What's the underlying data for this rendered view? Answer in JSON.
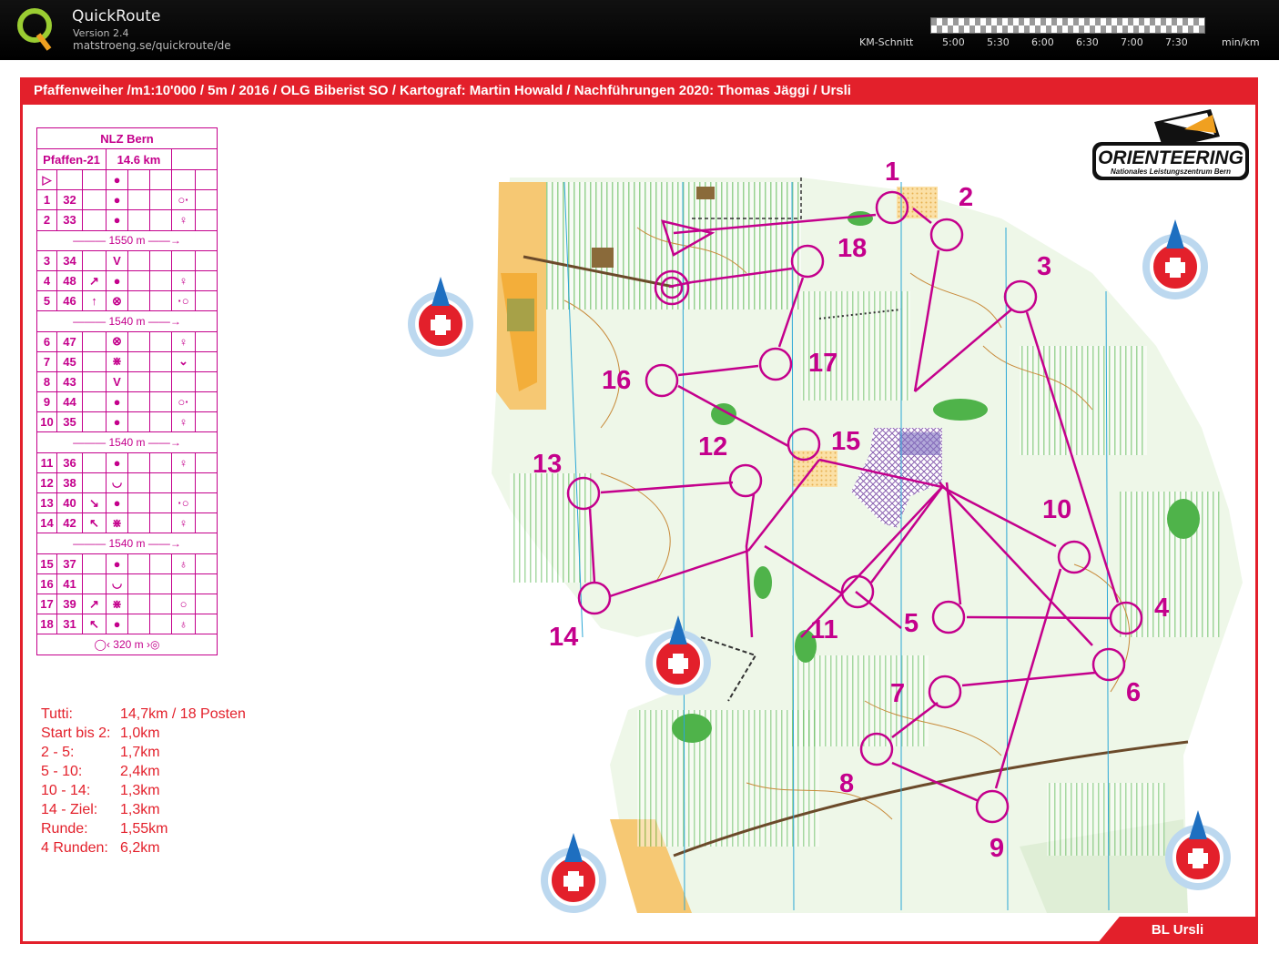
{
  "app": {
    "title": "QuickRoute",
    "version": "Version 2.4",
    "url": "matstroeng.se/quickroute/de"
  },
  "pace_scale": {
    "label": "KM-Schnitt",
    "ticks": [
      "5:00",
      "5:30",
      "6:00",
      "6:30",
      "7:00",
      "7:30"
    ],
    "unit": "min/km"
  },
  "map": {
    "title": "Pfaffenweiher /m1:10'000 / 5m / 2016 / OLG Biberist SO / Kartograf: Martin Howald / Nachführungen 2020: Thomas Jäggi / Ursli",
    "footer": "BL Ursli",
    "brand_main": "ORIENTEERING",
    "brand_sub": "Nationales Leistungszentrum Bern",
    "colors": {
      "frame": "#e3202b",
      "course": "#c4008c",
      "forest_green": "#6fc35a",
      "open": "#f6c873"
    }
  },
  "control_description": {
    "event": "NLZ Bern",
    "course": "Pfaffen-21",
    "length": "14.6 km",
    "controls": [
      {
        "n": "1",
        "code": "32",
        "dir": "",
        "sym": "●",
        "extra": "○·"
      },
      {
        "n": "2",
        "code": "33",
        "dir": "",
        "sym": "●",
        "extra": "♀"
      },
      {
        "leg": "1550 m"
      },
      {
        "n": "3",
        "code": "34",
        "dir": "",
        "sym": "V",
        "extra": ""
      },
      {
        "n": "4",
        "code": "48",
        "dir": "↗",
        "sym": "●",
        "extra": "♀"
      },
      {
        "n": "5",
        "code": "46",
        "dir": "↑",
        "sym": "⊗",
        "extra": "·○"
      },
      {
        "leg": "1540 m"
      },
      {
        "n": "6",
        "code": "47",
        "dir": "",
        "sym": "⊗",
        "extra": "♀"
      },
      {
        "n": "7",
        "code": "45",
        "dir": "",
        "sym": "⋇",
        "extra": "⌄"
      },
      {
        "n": "8",
        "code": "43",
        "dir": "",
        "sym": "V",
        "extra": ""
      },
      {
        "n": "9",
        "code": "44",
        "dir": "",
        "sym": "●",
        "extra": "○·"
      },
      {
        "n": "10",
        "code": "35",
        "dir": "",
        "sym": "●",
        "extra": "♀"
      },
      {
        "leg": "1540 m"
      },
      {
        "n": "11",
        "code": "36",
        "dir": "",
        "sym": "●",
        "extra": "♀"
      },
      {
        "n": "12",
        "code": "38",
        "dir": "",
        "sym": "◡",
        "extra": ""
      },
      {
        "n": "13",
        "code": "40",
        "dir": "↘",
        "sym": "●",
        "extra": "·○"
      },
      {
        "n": "14",
        "code": "42",
        "dir": "↖",
        "sym": "⋇",
        "extra": "♀"
      },
      {
        "leg": "1540 m"
      },
      {
        "n": "15",
        "code": "37",
        "dir": "",
        "sym": "●",
        "extra": "♁"
      },
      {
        "n": "16",
        "code": "41",
        "dir": "",
        "sym": "◡",
        "extra": ""
      },
      {
        "n": "17",
        "code": "39",
        "dir": "↗",
        "sym": "⋇",
        "extra": "○"
      },
      {
        "n": "18",
        "code": "31",
        "dir": "↖",
        "sym": "●",
        "extra": "♁"
      }
    ],
    "finish": "320 m"
  },
  "legs_info": [
    {
      "label": "Tutti:",
      "value": "14,7km / 18 Posten"
    },
    {
      "label": "Start bis 2:",
      "value": "1,0km"
    },
    {
      "label": "2 - 5:",
      "value": "1,7km"
    },
    {
      "label": "5 - 10:",
      "value": "2,4km"
    },
    {
      "label": "10 - 14:",
      "value": "1,3km"
    },
    {
      "label": "14 - Ziel:",
      "value": "1,3km"
    },
    {
      "label": "Runde:",
      "value": "1,55km"
    },
    {
      "label": "4 Runden:",
      "value": "6,2km"
    }
  ],
  "course_controls": [
    "1",
    "2",
    "3",
    "4",
    "5",
    "6",
    "7",
    "8",
    "9",
    "10",
    "11",
    "12",
    "13",
    "14",
    "15",
    "16",
    "17",
    "18"
  ],
  "compass_badges": [
    "north-arrow",
    "north-arrow",
    "north-arrow",
    "north-arrow",
    "north-arrow"
  ]
}
